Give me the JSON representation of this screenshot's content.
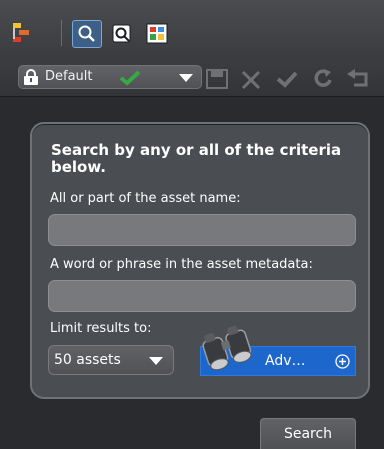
{
  "toolbar": {
    "icons": [
      "hierarchy-icon",
      "search-icon",
      "metadata-icon",
      "thumbnails-icon"
    ]
  },
  "preset_bar": {
    "preset_name": "Default",
    "actions": [
      "save-icon",
      "delete-icon",
      "apply-icon",
      "refresh-icon",
      "back-icon"
    ]
  },
  "search_panel": {
    "headline": "Search by any or all of the criteria below.",
    "name_label": "All or part of the asset name:",
    "name_value": "",
    "metadata_label": "A word or phrase in the asset metadata:",
    "metadata_value": "",
    "limit_label": "Limit results to:",
    "limit_value": "50 assets",
    "advanced_label": "Adv…"
  },
  "search_button": "Search",
  "colors": {
    "accent_blue": "#1d66cc",
    "panel": "#4a4d52",
    "field": "#77797d"
  }
}
